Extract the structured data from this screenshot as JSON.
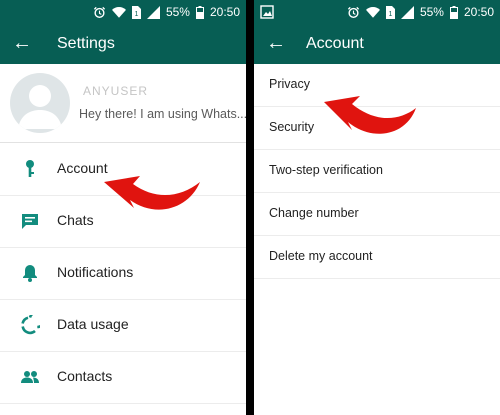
{
  "status_bar": {
    "battery_percent": "55%",
    "time": "20:50"
  },
  "settings_screen": {
    "title": "Settings",
    "profile": {
      "name": "ANYUSER",
      "status": "Hey there! I am using Whats..."
    },
    "menu": [
      {
        "label": "Account",
        "icon": "key-icon"
      },
      {
        "label": "Chats",
        "icon": "chat-icon"
      },
      {
        "label": "Notifications",
        "icon": "bell-icon"
      },
      {
        "label": "Data usage",
        "icon": "data-usage-icon"
      },
      {
        "label": "Contacts",
        "icon": "contacts-icon"
      }
    ]
  },
  "account_screen": {
    "title": "Account",
    "items": [
      "Privacy",
      "Security",
      "Two-step verification",
      "Change number",
      "Delete my account"
    ]
  },
  "colors": {
    "header": "#075e54",
    "icon": "#128c7e",
    "arrow": "#e0140f"
  }
}
